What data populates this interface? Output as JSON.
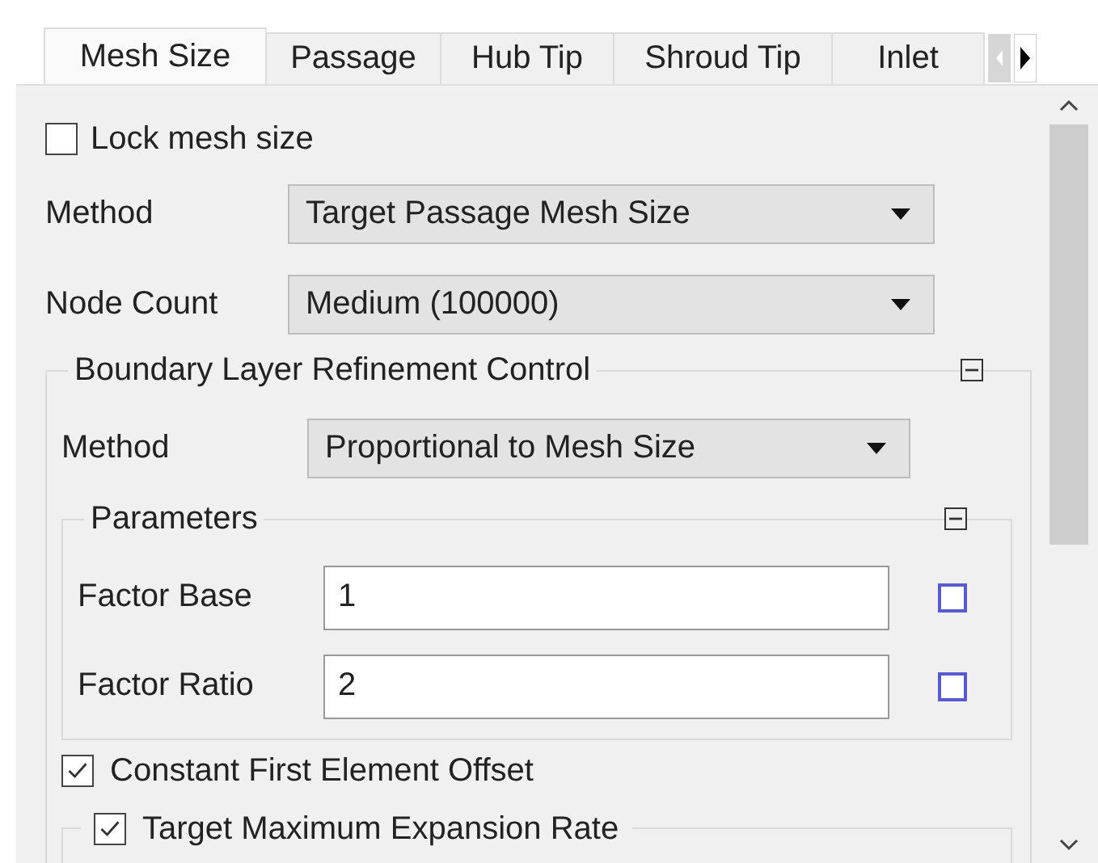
{
  "tabs": [
    {
      "label": "Mesh Size",
      "selected": true
    },
    {
      "label": "Passage",
      "selected": false
    },
    {
      "label": "Hub Tip",
      "selected": false
    },
    {
      "label": "Shroud Tip",
      "selected": false
    },
    {
      "label": "Inlet",
      "selected": false
    }
  ],
  "lock_mesh_size": {
    "label": "Lock mesh size",
    "checked": false
  },
  "method": {
    "label": "Method",
    "value": "Target Passage Mesh Size"
  },
  "node_count": {
    "label": "Node Count",
    "value": "Medium (100000)"
  },
  "boundary_layer": {
    "title": "Boundary Layer Refinement Control",
    "expanded": true,
    "method": {
      "label": "Method",
      "value": "Proportional to Mesh Size"
    },
    "parameters": {
      "title": "Parameters",
      "expanded": true,
      "fields": [
        {
          "label": "Factor Base",
          "value": "1",
          "checked": false
        },
        {
          "label": "Factor Ratio",
          "value": "2",
          "checked": false
        }
      ]
    },
    "constant_first_element_offset": {
      "label": "Constant First Element Offset",
      "checked": true
    },
    "target_maximum_expansion_rate": {
      "label": "Target Maximum Expansion Rate",
      "checked": true
    }
  }
}
